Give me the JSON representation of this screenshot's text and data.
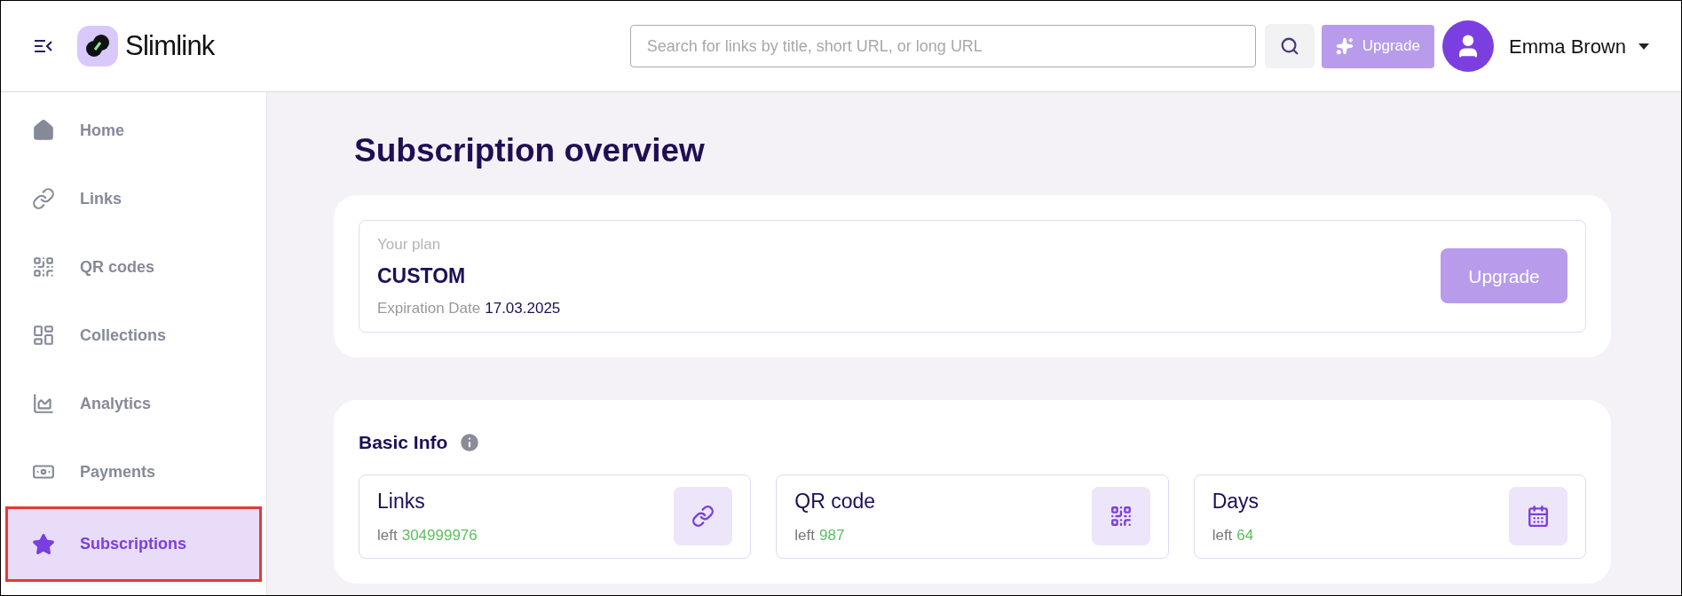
{
  "header": {
    "brand": "Slimlink",
    "search": {
      "placeholder": "Search for links by title, short URL, or long URL"
    },
    "upgrade_button": "Upgrade",
    "user_name": "Emma Brown"
  },
  "sidebar": {
    "items": [
      {
        "label": "Home",
        "selected": false
      },
      {
        "label": "Links",
        "selected": false
      },
      {
        "label": "QR codes",
        "selected": false
      },
      {
        "label": "Collections",
        "selected": false
      },
      {
        "label": "Analytics",
        "selected": false
      },
      {
        "label": "Payments",
        "selected": false
      },
      {
        "label": "Subscriptions",
        "selected": true
      }
    ]
  },
  "page_title": "Subscription overview",
  "plan": {
    "caption": "Your plan",
    "name": "CUSTOM",
    "expiration_label": "Expiration Date",
    "expiration_date": "17.03.2025",
    "button": "Upgrade"
  },
  "basic_info": {
    "title": "Basic Info",
    "cards": [
      {
        "title": "Links",
        "left_label": "left",
        "left_value": "304999976"
      },
      {
        "title": "QR code",
        "left_label": "left",
        "left_value": "987"
      },
      {
        "title": "Days",
        "left_label": "left",
        "left_value": "64"
      }
    ]
  }
}
